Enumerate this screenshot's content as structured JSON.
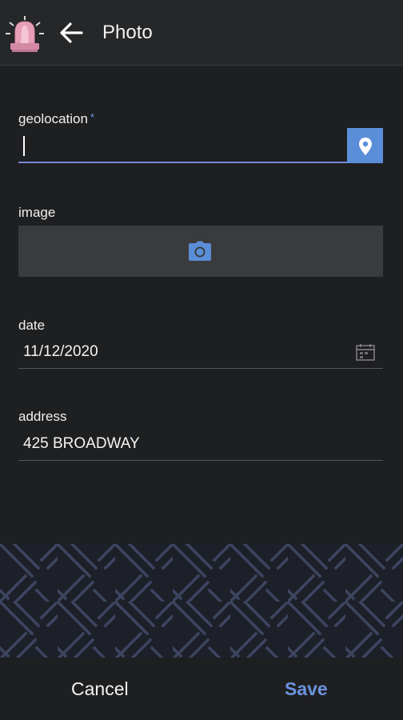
{
  "header": {
    "title": "Photo"
  },
  "form": {
    "geolocation": {
      "label": "geolocation",
      "required_mark": "*",
      "value": ""
    },
    "image": {
      "label": "image"
    },
    "date": {
      "label": "date",
      "value": "11/12/2020"
    },
    "address": {
      "label": "address",
      "value": "425 BROADWAY"
    }
  },
  "footer": {
    "cancel_label": "Cancel",
    "save_label": "Save"
  },
  "colors": {
    "accent": "#5b8ed8",
    "header_bg": "#262729",
    "form_bg": "#1e1f21"
  }
}
